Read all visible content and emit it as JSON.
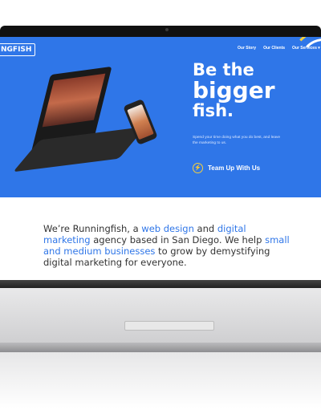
{
  "nav": {
    "logo": "NGFISH",
    "items": [
      {
        "label": "Our Story"
      },
      {
        "label": "Our Clients"
      },
      {
        "label": "Our Services ▾"
      }
    ]
  },
  "hero": {
    "headline_1": "Be the",
    "headline_2": "bigger",
    "headline_3": "fish.",
    "subtext": "Spend your time doing what you do best, and leave the marketing to us.",
    "cta_label": "Team Up With Us",
    "cta_icon": "lightning-icon"
  },
  "intro": {
    "p1": "We’re Runningfish, a ",
    "l1": "web design",
    "p2": " and ",
    "l2": "digital marketing",
    "p3": " agency based in San Diego. We help ",
    "l3": "small and medium businesses",
    "p4": " to grow by demystifying digital marketing for everyone."
  },
  "colors": {
    "brand_blue": "#2f76e8",
    "accent_yellow": "#f4d03f",
    "text": "#333333"
  }
}
